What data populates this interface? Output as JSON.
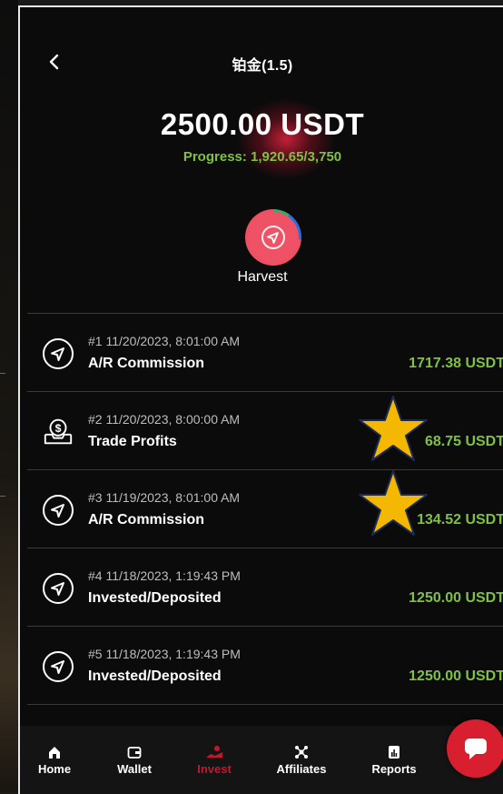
{
  "header": {
    "title": "铂金(1.5)",
    "amount": "2500.00 USDT",
    "progress": "Progress: 1,920.65/3,750"
  },
  "harvest": {
    "label": "Harvest"
  },
  "transactions": [
    {
      "meta": "#1  11/20/2023, 8:01:00 AM",
      "title": "A/R Commission",
      "amount": "1717.38 USDT",
      "icon": "send-icon"
    },
    {
      "meta": "#2  11/20/2023, 8:00:00 AM",
      "title": "Trade Profits",
      "amount": "68.75 USDT",
      "icon": "dollar-tray-icon"
    },
    {
      "meta": "#3  11/19/2023, 8:01:00 AM",
      "title": "A/R Commission",
      "amount": "134.52 USDT",
      "icon": "send-icon"
    },
    {
      "meta": "#4  11/18/2023, 1:19:43 PM",
      "title": "Invested/Deposited",
      "amount": "1250.00 USDT",
      "icon": "send-icon"
    },
    {
      "meta": "#5  11/18/2023, 1:19:43 PM",
      "title": "Invested/Deposited",
      "amount": "1250.00 USDT",
      "icon": "send-icon"
    }
  ],
  "tabs": [
    {
      "label": "Home",
      "icon": "home-icon"
    },
    {
      "label": "Wallet",
      "icon": "wallet-icon"
    },
    {
      "label": "Invest",
      "icon": "invest-icon",
      "active": true
    },
    {
      "label": "Affiliates",
      "icon": "affiliates-icon"
    },
    {
      "label": "Reports",
      "icon": "reports-icon"
    }
  ],
  "colors": {
    "accent_green": "#7fc241",
    "brand_red": "#d81f2f",
    "star": "#f5b800"
  }
}
